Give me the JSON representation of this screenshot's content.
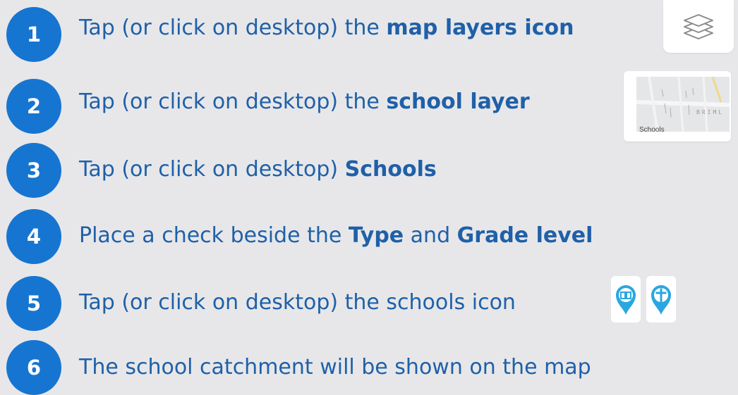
{
  "steps": [
    {
      "number": "1",
      "parts": [
        {
          "text": "Tap (or click on desktop) the ",
          "bold": false
        },
        {
          "text": "map layers icon",
          "bold": true
        }
      ]
    },
    {
      "number": "2",
      "parts": [
        {
          "text": "Tap (or click on desktop) the ",
          "bold": false
        },
        {
          "text": "school layer",
          "bold": true
        }
      ]
    },
    {
      "number": "3",
      "parts": [
        {
          "text": "Tap (or click on desktop) ",
          "bold": false
        },
        {
          "text": "Schools",
          "bold": true
        }
      ]
    },
    {
      "number": "4",
      "parts": [
        {
          "text": "Place a check beside the ",
          "bold": false
        },
        {
          "text": "Type",
          "bold": true
        },
        {
          "text": " and ",
          "bold": false
        },
        {
          "text": "Grade level",
          "bold": true
        }
      ]
    },
    {
      "number": "5",
      "parts": [
        {
          "text": "Tap (or click on desktop) the schools icon",
          "bold": false
        }
      ]
    },
    {
      "number": "6",
      "parts": [
        {
          "text": "The school catchment will be shown on the map",
          "bold": false
        }
      ]
    }
  ],
  "school_layer_thumbnail": {
    "label": "Schools",
    "map_text": "BRIML"
  },
  "icons": {
    "layers": "map-layers-icon",
    "school_pin": "school-book-pin-icon",
    "catholic_pin": "catholic-school-cross-pin-icon"
  },
  "colors": {
    "background": "#e7e7e9",
    "badge": "#1675d1",
    "text": "#1f60a8",
    "pin": "#2aa7e0"
  }
}
